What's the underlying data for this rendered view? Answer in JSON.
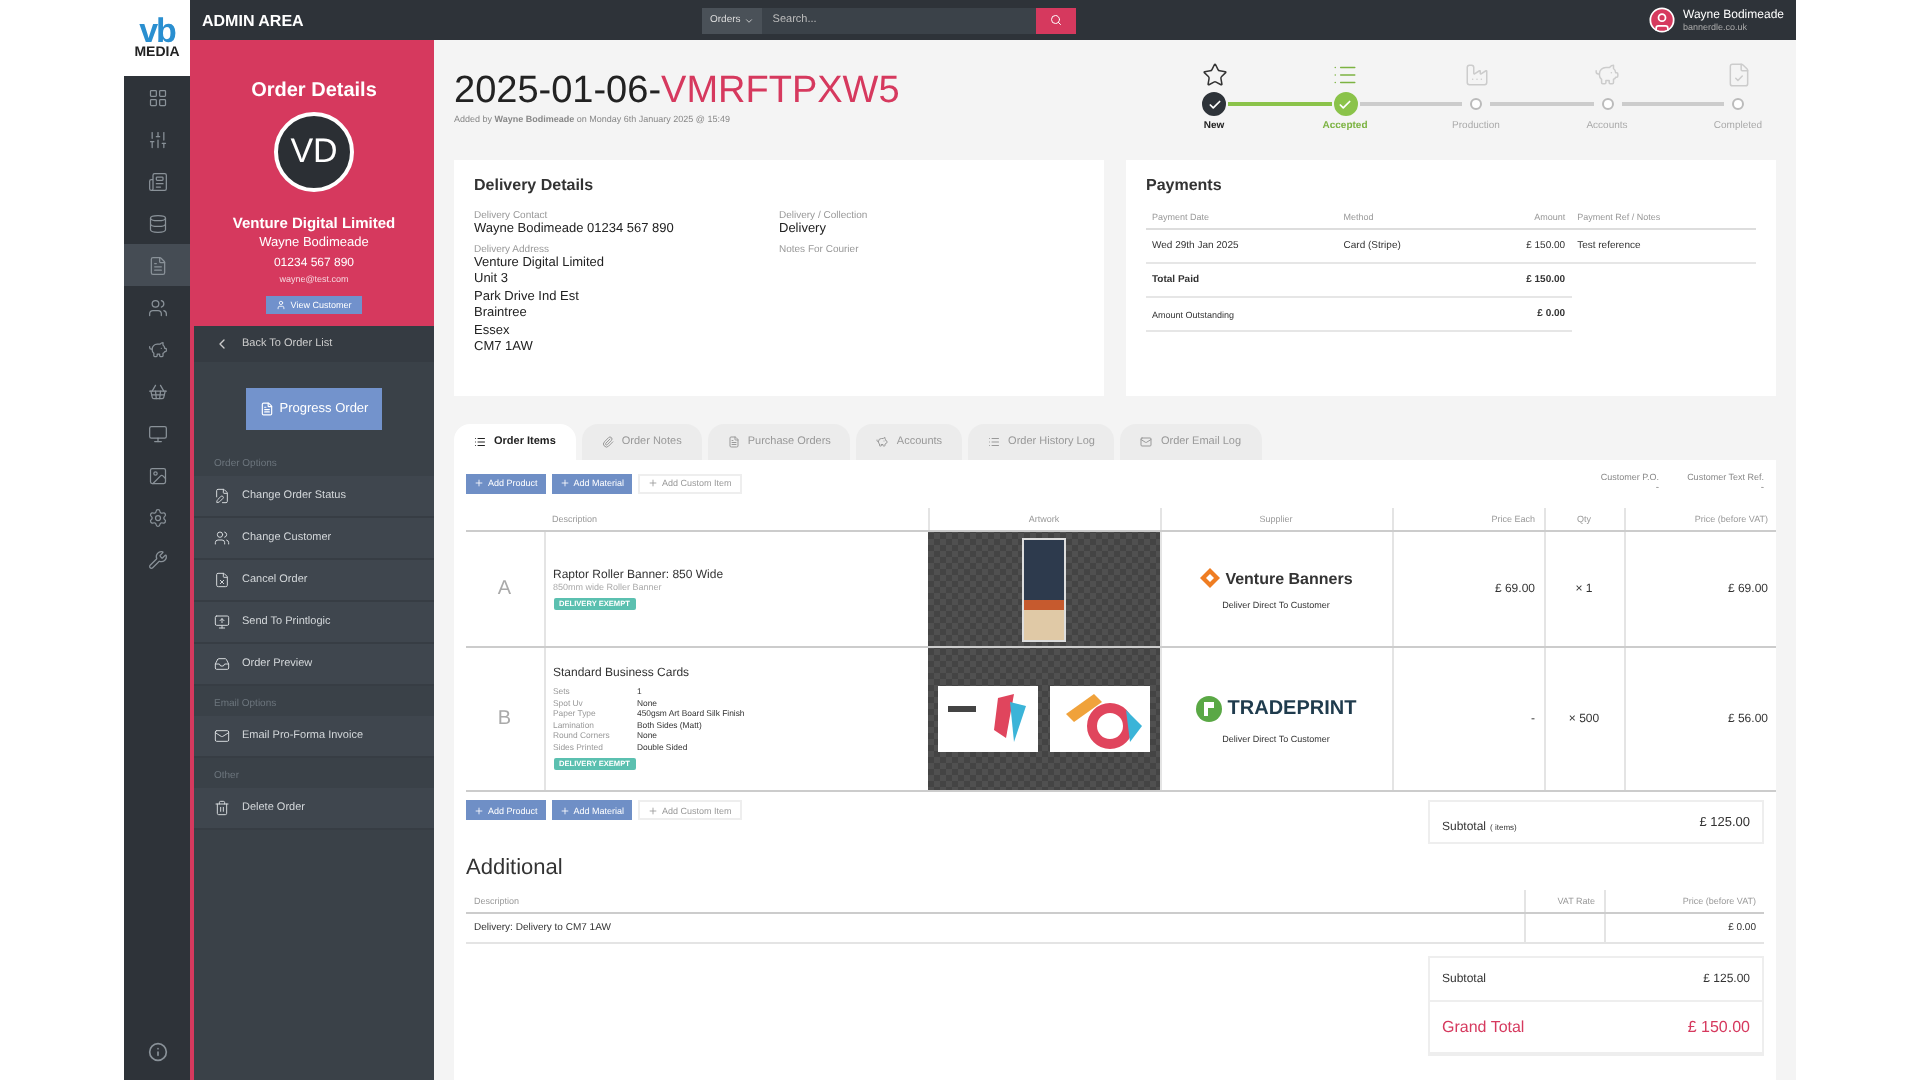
{
  "logo": {
    "mark": "vb",
    "word": "MEDIA"
  },
  "rail": [
    {
      "kind": "grid",
      "selected": false
    },
    {
      "kind": "sliders",
      "selected": false
    },
    {
      "kind": "news",
      "selected": false
    },
    {
      "kind": "database",
      "selected": false
    },
    {
      "kind": "file",
      "selected": true
    },
    {
      "kind": "people",
      "selected": false
    },
    {
      "kind": "piggy",
      "selected": false
    },
    {
      "kind": "basket",
      "selected": false
    },
    {
      "kind": "monitor",
      "selected": false
    },
    {
      "kind": "image",
      "selected": false
    },
    {
      "kind": "settings",
      "selected": false
    },
    {
      "kind": "wrench",
      "selected": false
    }
  ],
  "top_bar": {
    "title": "ADMIN AREA",
    "search": {
      "scope": "Orders",
      "placeholder": "Search..."
    },
    "user": {
      "name": "Wayne Bodimeade",
      "email": "bannerdle.co.uk"
    }
  },
  "order_panel": {
    "heading": "Order Details",
    "initials": "VD",
    "company": "Venture Digital Limited",
    "contact": "Wayne Bodimeade",
    "phone": "01234 567 890",
    "email": "wayne@test.com",
    "button": "View Customer"
  },
  "menu": {
    "back": "Back To Order List",
    "primary": "Progress Order",
    "sections": [
      {
        "title": "Order Options",
        "items": [
          {
            "label": "Change Order Status",
            "kind": "status"
          },
          {
            "label": "Change Customer",
            "kind": "customer"
          },
          {
            "label": "Cancel Order",
            "kind": "cancel"
          },
          {
            "label": "Send To Printlogic",
            "kind": "send"
          },
          {
            "label": "Order Preview",
            "kind": "preview"
          }
        ]
      },
      {
        "title": "Email Options",
        "items": [
          {
            "label": "Email Pro-Forma Invoice",
            "kind": "email"
          }
        ]
      },
      {
        "title": "Other",
        "items": [
          {
            "label": "Delete Order",
            "kind": "delete"
          }
        ]
      }
    ]
  },
  "order": {
    "date": "2025-01-06-",
    "ref": "VMRFTPXW5",
    "added": "Added by **Wayne Bodimeade** on Monday 6th January 2025 @ 15:49"
  },
  "steps": [
    {
      "label": "New",
      "kind": "star",
      "completed": true,
      "selected": false
    },
    {
      "label": "Accepted",
      "kind": "list",
      "completed": true,
      "selected": true
    },
    {
      "label": "Production",
      "kind": "factory",
      "completed": false,
      "selected": false
    },
    {
      "label": "Accounts",
      "kind": "piggy",
      "completed": false,
      "selected": false
    },
    {
      "label": "Completed",
      "kind": "file",
      "completed": false,
      "selected": false
    }
  ],
  "delivery": {
    "title": "Delivery Details",
    "contact_label": "Delivery Contact",
    "contact": "Wayne Bodimeade 01234 567 890",
    "address_label": "Delivery Address",
    "address": [
      "Venture Digital Limited",
      "Unit 3",
      "Park Drive Ind Est",
      "Braintree",
      "Essex",
      "CM7 1AW"
    ],
    "method_label": "Delivery / Collection",
    "method": "Delivery",
    "notes_label": "Notes For Courier"
  },
  "payments": {
    "title": "Payments",
    "columns": [
      "Payment Date",
      "Method",
      "Amount",
      "Payment Ref / Notes"
    ],
    "rows": [
      [
        "Wed 29th Jan 2025",
        "Card (Stripe)",
        "£ 150.00",
        "Test reference"
      ]
    ],
    "totals": [
      {
        "label": "Total Paid",
        "value": "£ 150.00",
        "kind": "strong"
      },
      {
        "label": "Amount Outstanding",
        "value": "£ 0.00",
        "kind": "note"
      }
    ]
  },
  "tabs": [
    {
      "label": "Order Items",
      "kind": "list",
      "selected": true
    },
    {
      "label": "Order Notes",
      "kind": "clip",
      "selected": false
    },
    {
      "label": "Purchase Orders",
      "kind": "file",
      "selected": false
    },
    {
      "label": "Accounts",
      "kind": "piggy",
      "selected": false
    },
    {
      "label": "Order History Log",
      "kind": "list",
      "selected": false
    },
    {
      "label": "Order Email Log",
      "kind": "mail",
      "selected": false
    }
  ],
  "toolbar_top": [
    {
      "label": "Add Product",
      "kind": "primary"
    },
    {
      "label": "Add Material",
      "kind": "primary"
    },
    {
      "label": "Add Custom Item",
      "kind": "plain"
    }
  ],
  "toolbar_bottom": [
    {
      "label": "Add Product",
      "kind": "primary"
    },
    {
      "label": "Add Material",
      "kind": "primary"
    },
    {
      "label": "Add Custom Item",
      "kind": "plain"
    }
  ],
  "customer_refs": [
    {
      "label": "Customer P.O.",
      "value": "-"
    },
    {
      "label": "Customer Text Ref.",
      "value": "-"
    }
  ],
  "items_table": {
    "columns": [
      "Description",
      "Artwork",
      "Supplier",
      "Price Each",
      "Qty",
      "Price (before VAT)"
    ],
    "rows": [
      {
        "letter": "A",
        "name": "Raptor Roller Banner: 850 Wide",
        "subtitle": "850mm wide Roller Banner",
        "specs": [],
        "badge": "DELIVERY EXEMPT",
        "kind": "banner",
        "supplier": {
          "name": "Venture Banners",
          "kind": "venture",
          "note": "Deliver Direct To Customer"
        },
        "price_each": "£ 69.00",
        "qty": "× 1",
        "price": "£ 69.00"
      },
      {
        "letter": "B",
        "name": "Standard Business Cards",
        "specs": [
          [
            "Sets",
            "1"
          ],
          [
            "Spot Uv",
            "None"
          ],
          [
            "Paper Type",
            "450gsm Art Board Silk Finish"
          ],
          [
            "Lamination",
            "Both Sides (Matt)"
          ],
          [
            "Round Corners",
            "None"
          ],
          [
            "Sides Printed",
            "Double Sided"
          ]
        ],
        "badge": "DELIVERY EXEMPT",
        "kind": "cards",
        "supplier": {
          "name": "TRADEPRINT",
          "kind": "tradeprint",
          "note": "Deliver Direct To Customer"
        },
        "price_each": "-",
        "qty": "× 500",
        "price": "£ 56.00"
      }
    ]
  },
  "subtotal": {
    "label": "Subtotal",
    "note": "( items)",
    "value": "£ 125.00"
  },
  "additional": {
    "title": "Additional",
    "columns": [
      "Description",
      "VAT Rate",
      "Price (before VAT)"
    ],
    "rows": [
      [
        "Delivery: Delivery to CM7 1AW",
        "",
        "£ 0.00"
      ]
    ],
    "totals": [
      {
        "label": "Subtotal",
        "value": "£ 125.00",
        "kind": "normal"
      },
      {
        "label": "Grand Total",
        "value": "£ 150.00",
        "kind": "grand"
      }
    ]
  }
}
